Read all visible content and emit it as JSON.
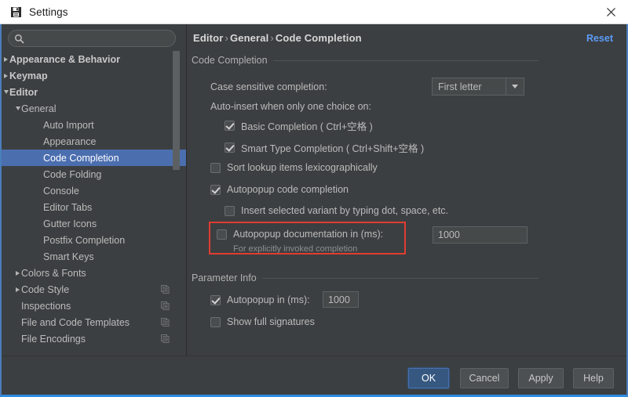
{
  "window": {
    "title": "Settings",
    "icon": "save-disk-icon",
    "close_icon": "close-icon"
  },
  "search": {
    "value": "",
    "placeholder": "",
    "icon": "search-icon"
  },
  "sidebar": {
    "items": [
      {
        "label": "Appearance & Behavior",
        "indent": 10,
        "arrow": "right",
        "bold": true,
        "selected": false,
        "badge": false
      },
      {
        "label": "Keymap",
        "indent": 10,
        "arrow": "right",
        "bold": true,
        "selected": false,
        "badge": false
      },
      {
        "label": "Editor",
        "indent": 10,
        "arrow": "down",
        "bold": true,
        "selected": false,
        "badge": false
      },
      {
        "label": "General",
        "indent": 25,
        "arrow": "down",
        "bold": false,
        "selected": false,
        "badge": false
      },
      {
        "label": "Auto Import",
        "indent": 53,
        "arrow": "none",
        "bold": false,
        "selected": false,
        "badge": false
      },
      {
        "label": "Appearance",
        "indent": 53,
        "arrow": "none",
        "bold": false,
        "selected": false,
        "badge": false
      },
      {
        "label": "Code Completion",
        "indent": 53,
        "arrow": "none",
        "bold": false,
        "selected": true,
        "badge": false
      },
      {
        "label": "Code Folding",
        "indent": 53,
        "arrow": "none",
        "bold": false,
        "selected": false,
        "badge": false
      },
      {
        "label": "Console",
        "indent": 53,
        "arrow": "none",
        "bold": false,
        "selected": false,
        "badge": false
      },
      {
        "label": "Editor Tabs",
        "indent": 53,
        "arrow": "none",
        "bold": false,
        "selected": false,
        "badge": false
      },
      {
        "label": "Gutter Icons",
        "indent": 53,
        "arrow": "none",
        "bold": false,
        "selected": false,
        "badge": false
      },
      {
        "label": "Postfix Completion",
        "indent": 53,
        "arrow": "none",
        "bold": false,
        "selected": false,
        "badge": false
      },
      {
        "label": "Smart Keys",
        "indent": 53,
        "arrow": "none",
        "bold": false,
        "selected": false,
        "badge": false
      },
      {
        "label": "Colors & Fonts",
        "indent": 25,
        "arrow": "right",
        "bold": false,
        "selected": false,
        "badge": false
      },
      {
        "label": "Code Style",
        "indent": 25,
        "arrow": "right",
        "bold": false,
        "selected": false,
        "badge": true
      },
      {
        "label": "Inspections",
        "indent": 25,
        "arrow": "none",
        "bold": false,
        "selected": false,
        "badge": true
      },
      {
        "label": "File and Code Templates",
        "indent": 25,
        "arrow": "none",
        "bold": false,
        "selected": false,
        "badge": true
      },
      {
        "label": "File Encodings",
        "indent": 25,
        "arrow": "none",
        "bold": false,
        "selected": false,
        "badge": true
      }
    ],
    "scrollbar": {
      "name": "sidebar-scrollbar"
    }
  },
  "content": {
    "breadcrumb": {
      "part1": "Editor",
      "sep1": "›",
      "part2": "General",
      "sep2": "›",
      "part3": "Code Completion"
    },
    "reset_label": "Reset",
    "groups": [
      {
        "title": "Code Completion"
      },
      {
        "title": "Parameter Info"
      }
    ],
    "code_completion": {
      "case_sensitive_label": "Case sensitive completion:",
      "case_sensitive_value": "First letter",
      "auto_insert_label": "Auto-insert when only one choice on:",
      "basic_completion_label": "Basic Completion ( Ctrl+空格 )",
      "basic_completion_checked": true,
      "smart_type_label": "Smart Type Completion ( Ctrl+Shift+空格 )",
      "smart_type_checked": true,
      "sort_lookup_label": "Sort lookup items lexicographically",
      "sort_lookup_checked": false,
      "autopopup_code_label": "Autopopup code completion",
      "autopopup_code_checked": true,
      "insert_variant_label": "Insert selected variant by typing dot, space, etc.",
      "insert_variant_checked": false,
      "autopopup_doc_label": "Autopopup documentation in (ms):",
      "autopopup_doc_checked": false,
      "autopopup_doc_hint": "For explicitly invoked completion",
      "autopopup_doc_value": "1000"
    },
    "parameter_info": {
      "autopopup_label": "Autopopup in (ms):",
      "autopopup_checked": true,
      "autopopup_value": "1000",
      "show_full_signatures_label": "Show full signatures",
      "show_full_signatures_checked": false
    }
  },
  "footer": {
    "buttons": [
      {
        "label": "OK",
        "primary": true
      },
      {
        "label": "Cancel",
        "primary": false
      },
      {
        "label": "Apply",
        "primary": false
      },
      {
        "label": "Help",
        "primary": false
      }
    ]
  },
  "colors": {
    "window_bg": "#3c3f41",
    "selection": "#4b6eaf",
    "accent_link": "#5b9bf8",
    "highlight_box": "#e03c31",
    "primary_button": "#365880",
    "titlebar_bg": "#ffffff",
    "bottom_accent": "#2f8ce0"
  }
}
